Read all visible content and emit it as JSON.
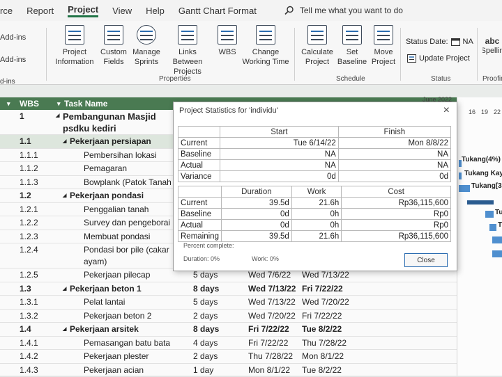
{
  "menu": {
    "tabs": [
      "rce",
      "Report",
      "Project",
      "View",
      "Help",
      "Gantt Chart Format"
    ],
    "tell_me": "Tell me what you want to do"
  },
  "ribbon": {
    "left_items": [
      "Add-ins",
      "Add-ins",
      "d-ins"
    ],
    "buttons": {
      "project_information": "Project Information",
      "custom_fields": "Custom Fields",
      "manage_sprints": "Manage Sprints",
      "links_between": "Links Between Projects",
      "wbs": "WBS",
      "change_working_time": "Change Working Time",
      "calculate_project": "Calculate Project",
      "set_baseline": "Set Baseline",
      "move_project": "Move Project",
      "spelling": "Spellin"
    },
    "groups": {
      "properties": "Properties",
      "schedule": "Schedule",
      "status": "Status",
      "proofing": "Proofin"
    },
    "status_date_label": "Status Date:",
    "status_date_value": "NA",
    "update_project": "Update Project",
    "abc": "abc"
  },
  "sheet": {
    "headers": {
      "wbs": "WBS",
      "task": "Task Name"
    },
    "timeline": {
      "month": "June 2022",
      "days": [
        "16",
        "19",
        "22"
      ]
    },
    "rows": [
      {
        "wbs": "1",
        "task": "Pembangunan Masjid",
        "task2": "psdku kediri",
        "dur": "",
        "start": "",
        "finish": ""
      },
      {
        "wbs": "1.1",
        "task": "Pekerjaan persiapan",
        "dur": "",
        "start": "",
        "finish": ""
      },
      {
        "wbs": "1.1.1",
        "task": "Pembersihan lokasi",
        "dur": "",
        "start": "",
        "finish": ""
      },
      {
        "wbs": "1.1.2",
        "task": "Pemagaran",
        "dur": "",
        "start": "",
        "finish": ""
      },
      {
        "wbs": "1.1.3",
        "task": "Bowplank (Patok Tanah",
        "dur": "",
        "start": "",
        "finish": ""
      },
      {
        "wbs": "1.2",
        "task": "Pekerjaan pondasi",
        "dur": "",
        "start": "",
        "finish": ""
      },
      {
        "wbs": "1.2.1",
        "task": "Penggalian tanah",
        "dur": "",
        "start": "",
        "finish": ""
      },
      {
        "wbs": "1.2.2",
        "task": "Survey dan pengeborai",
        "dur": "",
        "start": "",
        "finish": ""
      },
      {
        "wbs": "1.2.3",
        "task": "Membuat pondasi",
        "dur": "",
        "start": "",
        "finish": ""
      },
      {
        "wbs": "1.2.4",
        "task": "Pondasi bor pile (cakar",
        "task2": "ayam)",
        "dur": "",
        "start": "",
        "finish": ""
      },
      {
        "wbs": "1.2.5",
        "task": "Pekerjaan pilecap",
        "dur": "5 days",
        "start": "Wed 7/6/22",
        "finish": "Wed 7/13/22"
      },
      {
        "wbs": "1.3",
        "task": "Pekerjaan beton 1",
        "dur": "8 days",
        "start": "Wed 7/13/22",
        "finish": "Fri 7/22/22"
      },
      {
        "wbs": "1.3.1",
        "task": "Pelat lantai",
        "dur": "5 days",
        "start": "Wed 7/13/22",
        "finish": "Wed 7/20/22"
      },
      {
        "wbs": "1.3.2",
        "task": "Pekerjaan beton 2",
        "dur": "2 days",
        "start": "Wed 7/20/22",
        "finish": "Fri 7/22/22"
      },
      {
        "wbs": "1.4",
        "task": "Pekerjaan arsitek",
        "dur": "8 days",
        "start": "Fri 7/22/22",
        "finish": "Tue 8/2/22"
      },
      {
        "wbs": "1.4.1",
        "task": "Pemasangan batu bata",
        "dur": "4 days",
        "start": "Fri 7/22/22",
        "finish": "Thu 7/28/22"
      },
      {
        "wbs": "1.4.2",
        "task": "Pekerjaan plester",
        "dur": "2 days",
        "start": "Thu 7/28/22",
        "finish": "Mon 8/1/22"
      },
      {
        "wbs": "1.4.3",
        "task": "Pekerjaan acian",
        "dur": "1 day",
        "start": "Mon 8/1/22",
        "finish": "Tue 8/2/22"
      }
    ],
    "gantt_labels": [
      "Tukang(4%)",
      "Tukang Kay",
      "Tukang[3",
      "Tu",
      "T"
    ]
  },
  "dialog": {
    "title": "Project Statistics for 'individu'",
    "close": "×",
    "dates": {
      "headers": [
        "",
        "Start",
        "Finish"
      ],
      "rows": [
        {
          "label": "Current",
          "start": "Tue 6/14/22",
          "finish": "Mon 8/8/22"
        },
        {
          "label": "Baseline",
          "start": "NA",
          "finish": "NA"
        },
        {
          "label": "Actual",
          "start": "NA",
          "finish": "NA"
        },
        {
          "label": "Variance",
          "start": "0d",
          "finish": "0d"
        }
      ]
    },
    "work": {
      "headers": [
        "",
        "Duration",
        "Work",
        "Cost"
      ],
      "rows": [
        {
          "label": "Current",
          "duration": "39.5d",
          "work": "21.6h",
          "cost": "Rp36,115,600"
        },
        {
          "label": "Baseline",
          "duration": "0d",
          "work": "0h",
          "cost": "Rp0"
        },
        {
          "label": "Actual",
          "duration": "0d",
          "work": "0h",
          "cost": "Rp0"
        },
        {
          "label": "Remaining",
          "duration": "39.5d",
          "work": "21.6h",
          "cost": "Rp36,115,600"
        }
      ]
    },
    "percent_complete": "Percent complete:",
    "duration_pct": "Duration:  0%",
    "work_pct": "Work:  0%",
    "close_button": "Close"
  }
}
